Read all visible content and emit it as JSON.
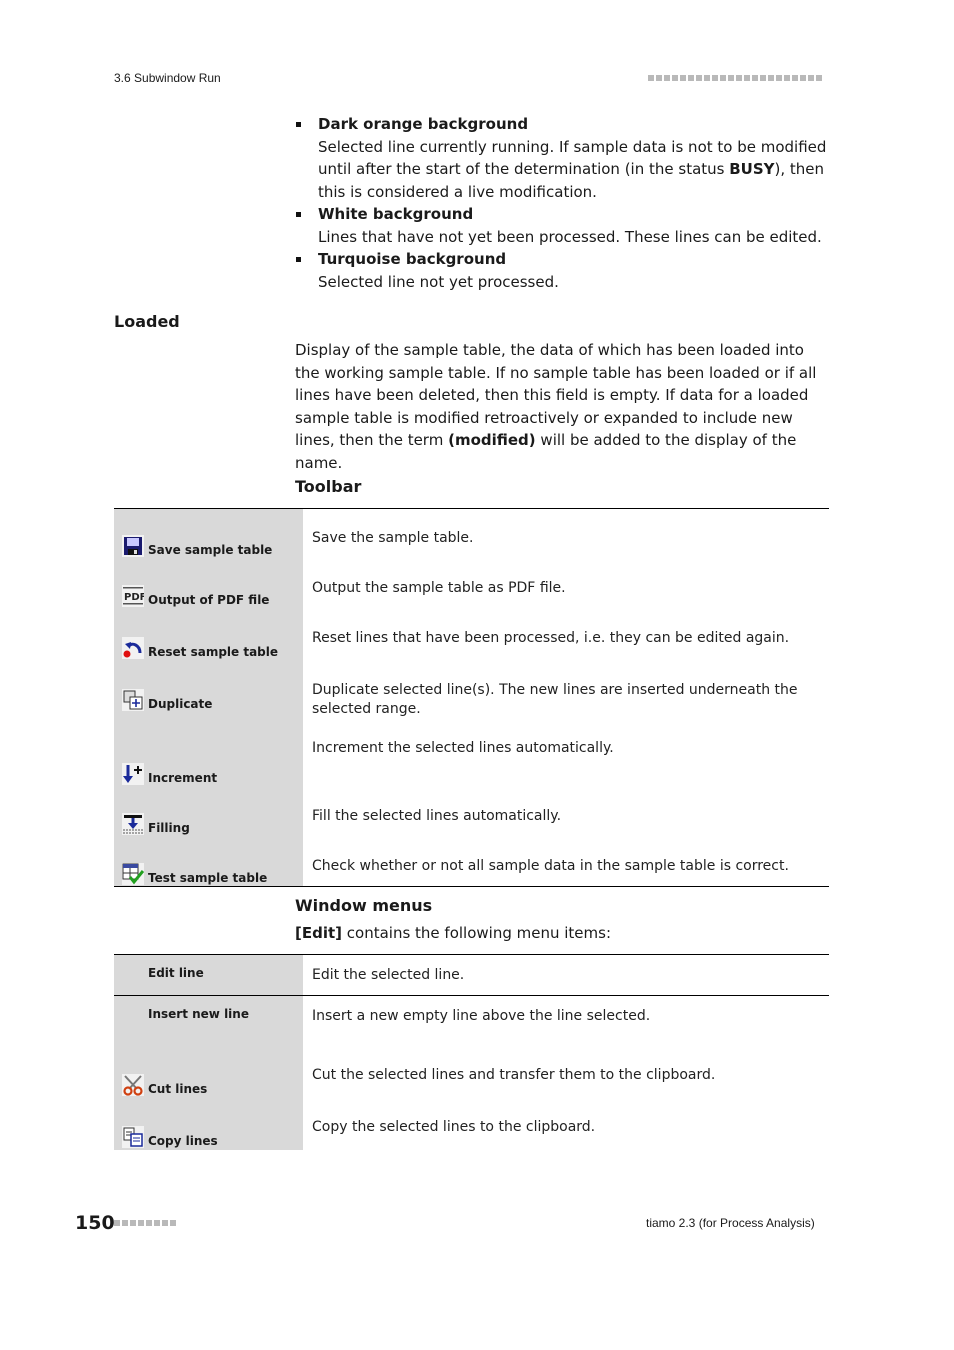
{
  "header": {
    "section": "3.6 Subwindow Run",
    "decoration_dots": 22
  },
  "status_bullets": [
    {
      "title": "Dark orange background",
      "text_before": "Selected line currently running. If sample data is not to be modified until after the start of the determination (in the status ",
      "bold": "BUSY",
      "text_after": "), then this is considered a live modification."
    },
    {
      "title": "White background",
      "text_before": "Lines that have not yet been processed. These lines can be edited.",
      "bold": "",
      "text_after": ""
    },
    {
      "title": "Turquoise background",
      "text_before": "Selected line not yet processed.",
      "bold": "",
      "text_after": ""
    }
  ],
  "loaded": {
    "heading": "Loaded",
    "text_before": "Display of the sample table, the data of which has been loaded into the working sample table. If no sample table has been loaded or if all lines have been deleted, then this field is empty. If data for a loaded sample table is modified retroactively or expanded to include new lines, then the term ",
    "bold": "(modified)",
    "text_after": " will be added to the display of the name."
  },
  "toolbar": {
    "heading": "Toolbar",
    "items": [
      {
        "icon": "save-icon",
        "label": "Save sample table",
        "desc": "Save the sample table."
      },
      {
        "icon": "pdf-icon",
        "label": "Output of PDF file",
        "desc": "Output the sample table as PDF file."
      },
      {
        "icon": "reset-icon",
        "label": "Reset sample table",
        "desc": "Reset lines that have been processed, i.e. they can be edited again."
      },
      {
        "icon": "duplicate-icon",
        "label": "Duplicate",
        "desc": "Duplicate selected line(s). The new lines are inserted underneath the selected range."
      },
      {
        "icon": "increment-icon",
        "label": "Increment",
        "desc": "Increment the selected lines automatically."
      },
      {
        "icon": "filling-icon",
        "label": "Filling",
        "desc": "Fill the selected lines automatically."
      },
      {
        "icon": "test-table-icon",
        "label": "Test sample table",
        "desc": "Check whether or not all sample data in the sample table is correct."
      }
    ]
  },
  "window_menus": {
    "heading": "Window menus",
    "intro_bold": "[Edit]",
    "intro_text": " contains the following menu items:",
    "items": [
      {
        "icon": "",
        "label": "Edit line",
        "desc": "Edit the selected line."
      },
      {
        "icon": "",
        "label": "Insert new line",
        "desc": "Insert a new empty line above the line selected."
      },
      {
        "icon": "scissors-icon",
        "label": "Cut lines",
        "desc": "Cut the selected lines and transfer them to the clipboard."
      },
      {
        "icon": "copy-icon",
        "label": "Copy lines",
        "desc": "Copy the selected lines to the clipboard."
      }
    ]
  },
  "footer": {
    "page_number": "150",
    "product": "tiamo 2.3 (for Process Analysis)"
  }
}
